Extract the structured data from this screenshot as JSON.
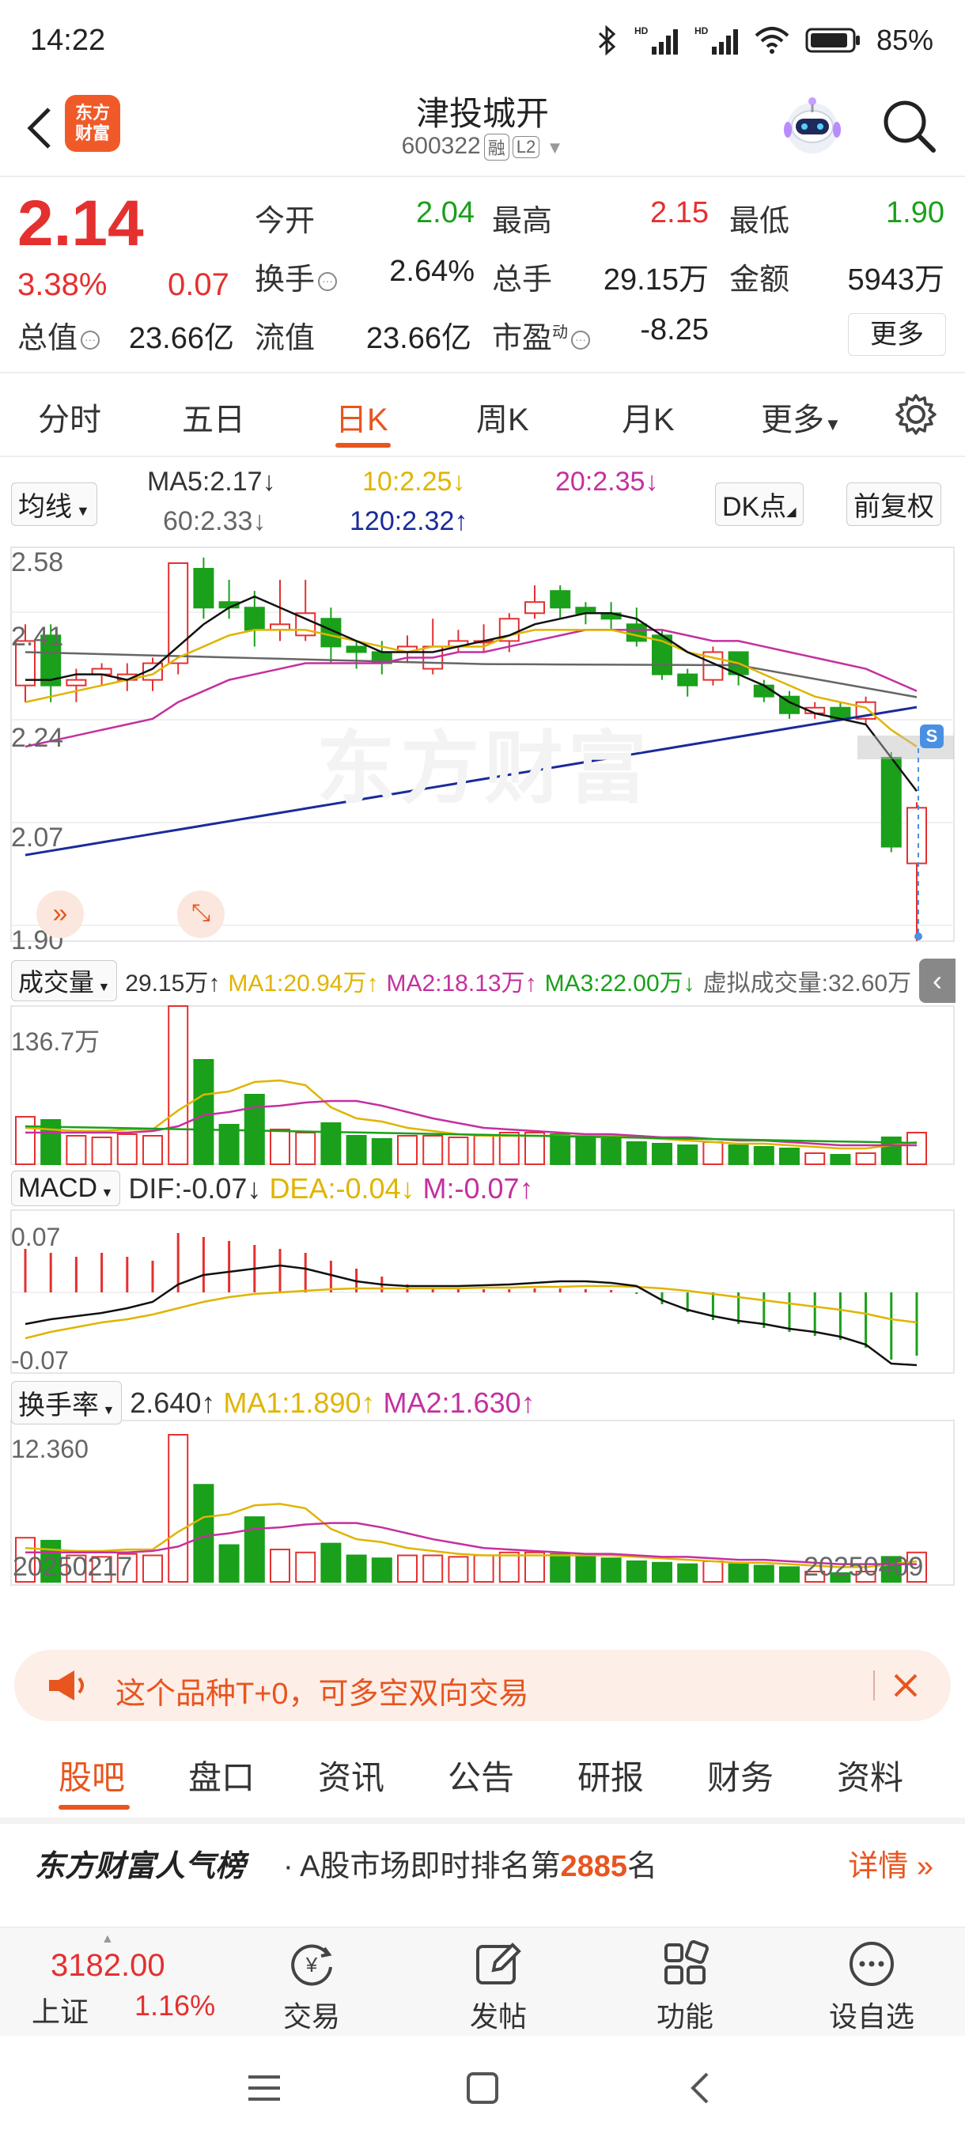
{
  "status": {
    "time": "14:22",
    "battery": "85%",
    "net1": "HD",
    "net2": "HD"
  },
  "header": {
    "logo_line1": "东方",
    "logo_line2": "财富",
    "title": "津投城开",
    "code": "600322",
    "tag1": "融",
    "tag2": "L2"
  },
  "quote": {
    "price": "2.14",
    "change_pct": "3.38%",
    "change_val": "0.07",
    "fields": {
      "open_label": "今开",
      "open": "2.04",
      "high_label": "最高",
      "high": "2.15",
      "low_label": "最低",
      "low": "1.90",
      "turnover_label": "换手",
      "turnover": "2.64%",
      "volume_label": "总手",
      "volume": "29.15万",
      "amount_label": "金额",
      "amount": "5943万",
      "mcap_label": "总值",
      "mcap": "23.66亿",
      "float_label": "流值",
      "float": "23.66亿",
      "pe_label": "市盈",
      "pe_sup": "动",
      "pe": "-8.25"
    },
    "more_label": "更多"
  },
  "tabs": [
    "分时",
    "五日",
    "日K",
    "周K",
    "月K",
    "更多"
  ],
  "active_tab": "日K",
  "kline": {
    "ma_selector": "均线",
    "ma5": "MA5:2.17",
    "ma10": "10:2.25",
    "ma20": "20:2.35",
    "ma60": "60:2.33",
    "ma120": "120:2.32",
    "dk_label": "DK点",
    "adjust_label": "前复权",
    "y_labels": [
      "2.58",
      "2.41",
      "2.24",
      "2.07",
      "1.90"
    ],
    "watermark": "东方财富",
    "marker_s": "S"
  },
  "volume": {
    "selector": "成交量",
    "current": "29.15万",
    "ma1": "MA1:20.94万",
    "ma2": "MA2:18.13万",
    "ma3": "MA3:22.00万",
    "virtual": "虚拟成交量:32.60万",
    "max_label": "136.7万"
  },
  "macd": {
    "selector": "MACD",
    "dif": "DIF:-0.07",
    "dea": "DEA:-0.04",
    "m": "M:-0.07",
    "top_label": "0.07",
    "bottom_label": "-0.07"
  },
  "turnover_panel": {
    "selector": "换手率",
    "current": "2.640",
    "ma1": "MA1:1.890",
    "ma2": "MA2:1.630",
    "max_label": "12.360",
    "date_start": "20250217",
    "date_end": "20250409"
  },
  "colors": {
    "up": "#e53030",
    "down": "#1aa01a",
    "accent": "#e8551f",
    "ma5": "#111111",
    "ma10": "#e0b400",
    "ma20": "#c4309f",
    "ma60": "#666666",
    "ma120": "#1a2b9a"
  },
  "banner": {
    "text": "这个品种T+0，可多空双向交易"
  },
  "subtabs": [
    "股吧",
    "盘口",
    "资讯",
    "公告",
    "研报",
    "财务",
    "资料"
  ],
  "popular": {
    "title": "东方财富人气榜",
    "prefix": "· A股市场即时排名第",
    "rank": "2885",
    "suffix": "名",
    "more": "详情"
  },
  "bottom_nav": {
    "index_value": "3182.00",
    "index_name": "上证",
    "index_pct": "1.16%",
    "items": [
      "交易",
      "发帖",
      "功能",
      "设自选"
    ]
  }
}
